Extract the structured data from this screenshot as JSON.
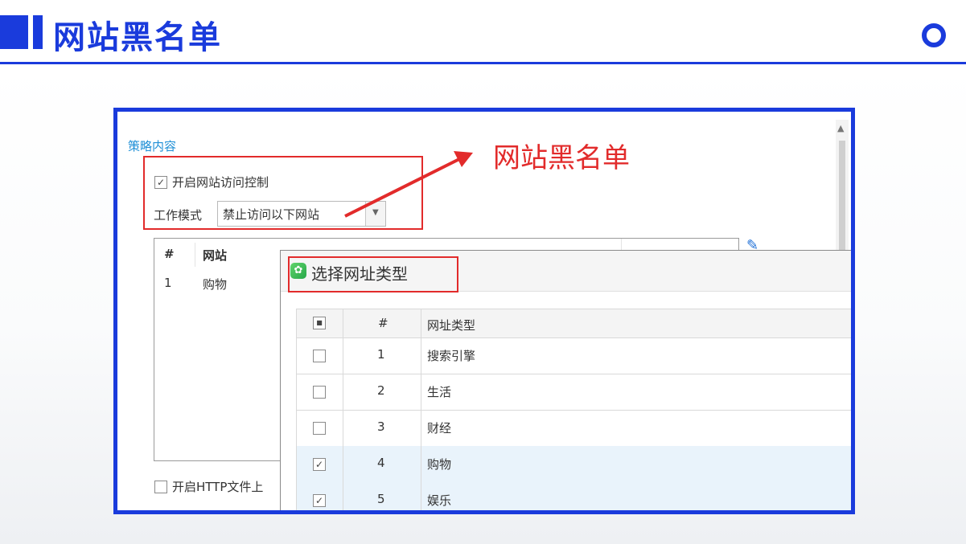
{
  "header": {
    "title": "网站黑名单"
  },
  "policy": {
    "section_title": "策略内容",
    "enable_site_control": {
      "label": "开启网站访问控制",
      "checked": true
    },
    "work_mode_label": "工作模式",
    "work_mode_value": "禁止访问以下网站",
    "list": {
      "columns": [
        "#",
        "网站"
      ],
      "rows": [
        {
          "num": "1",
          "site": "购物"
        }
      ]
    },
    "enable_http_upload": {
      "label": "开启HTTP文件上",
      "checked": false
    }
  },
  "annotation": {
    "text": "网站黑名单"
  },
  "dialog": {
    "title": "选择网址类型",
    "columns": [
      "#",
      "网址类型"
    ],
    "rows": [
      {
        "num": "1",
        "type": "搜索引擎",
        "checked": false
      },
      {
        "num": "2",
        "type": "生活",
        "checked": false
      },
      {
        "num": "3",
        "type": "财经",
        "checked": false
      },
      {
        "num": "4",
        "type": "购物",
        "checked": true
      },
      {
        "num": "5",
        "type": "娱乐",
        "checked": true
      }
    ]
  },
  "colors": {
    "brand_blue": "#1a3bdc",
    "annotation_red": "#e22b2b",
    "section_blue": "#1e8fd6"
  }
}
